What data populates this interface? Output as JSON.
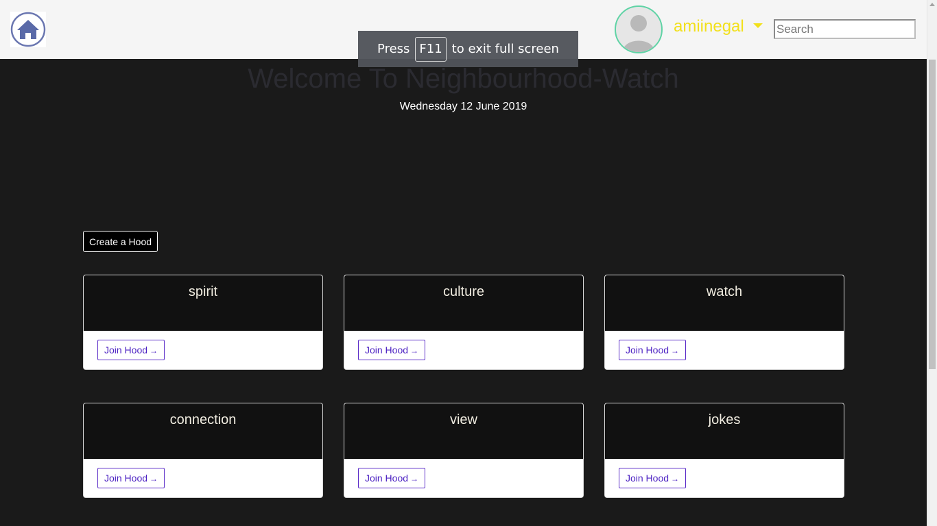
{
  "nav": {
    "home_icon": "house-icon",
    "avatar_icon": "user-silhouette-icon",
    "username": "amiinegal",
    "search_placeholder": "Search",
    "accent": "#f2e01a"
  },
  "fullscreen_toast": {
    "press": "Press",
    "key": "F11",
    "rest": "to exit full screen"
  },
  "header": {
    "title": "Welcome To Neighbourhood-Watch",
    "date": "Wednesday 12 June 2019"
  },
  "actions": {
    "create_label": "Create a Hood"
  },
  "hoods": [
    {
      "name": "spirit",
      "join_label": "Join Hood",
      "arrow": "→"
    },
    {
      "name": "culture",
      "join_label": "Join Hood",
      "arrow": "→"
    },
    {
      "name": "watch",
      "join_label": "Join Hood",
      "arrow": "→"
    },
    {
      "name": "connection",
      "join_label": "Join Hood",
      "arrow": "→"
    },
    {
      "name": "view",
      "join_label": "Join Hood",
      "arrow": "→"
    },
    {
      "name": "jokes",
      "join_label": "Join Hood",
      "arrow": "→"
    }
  ]
}
